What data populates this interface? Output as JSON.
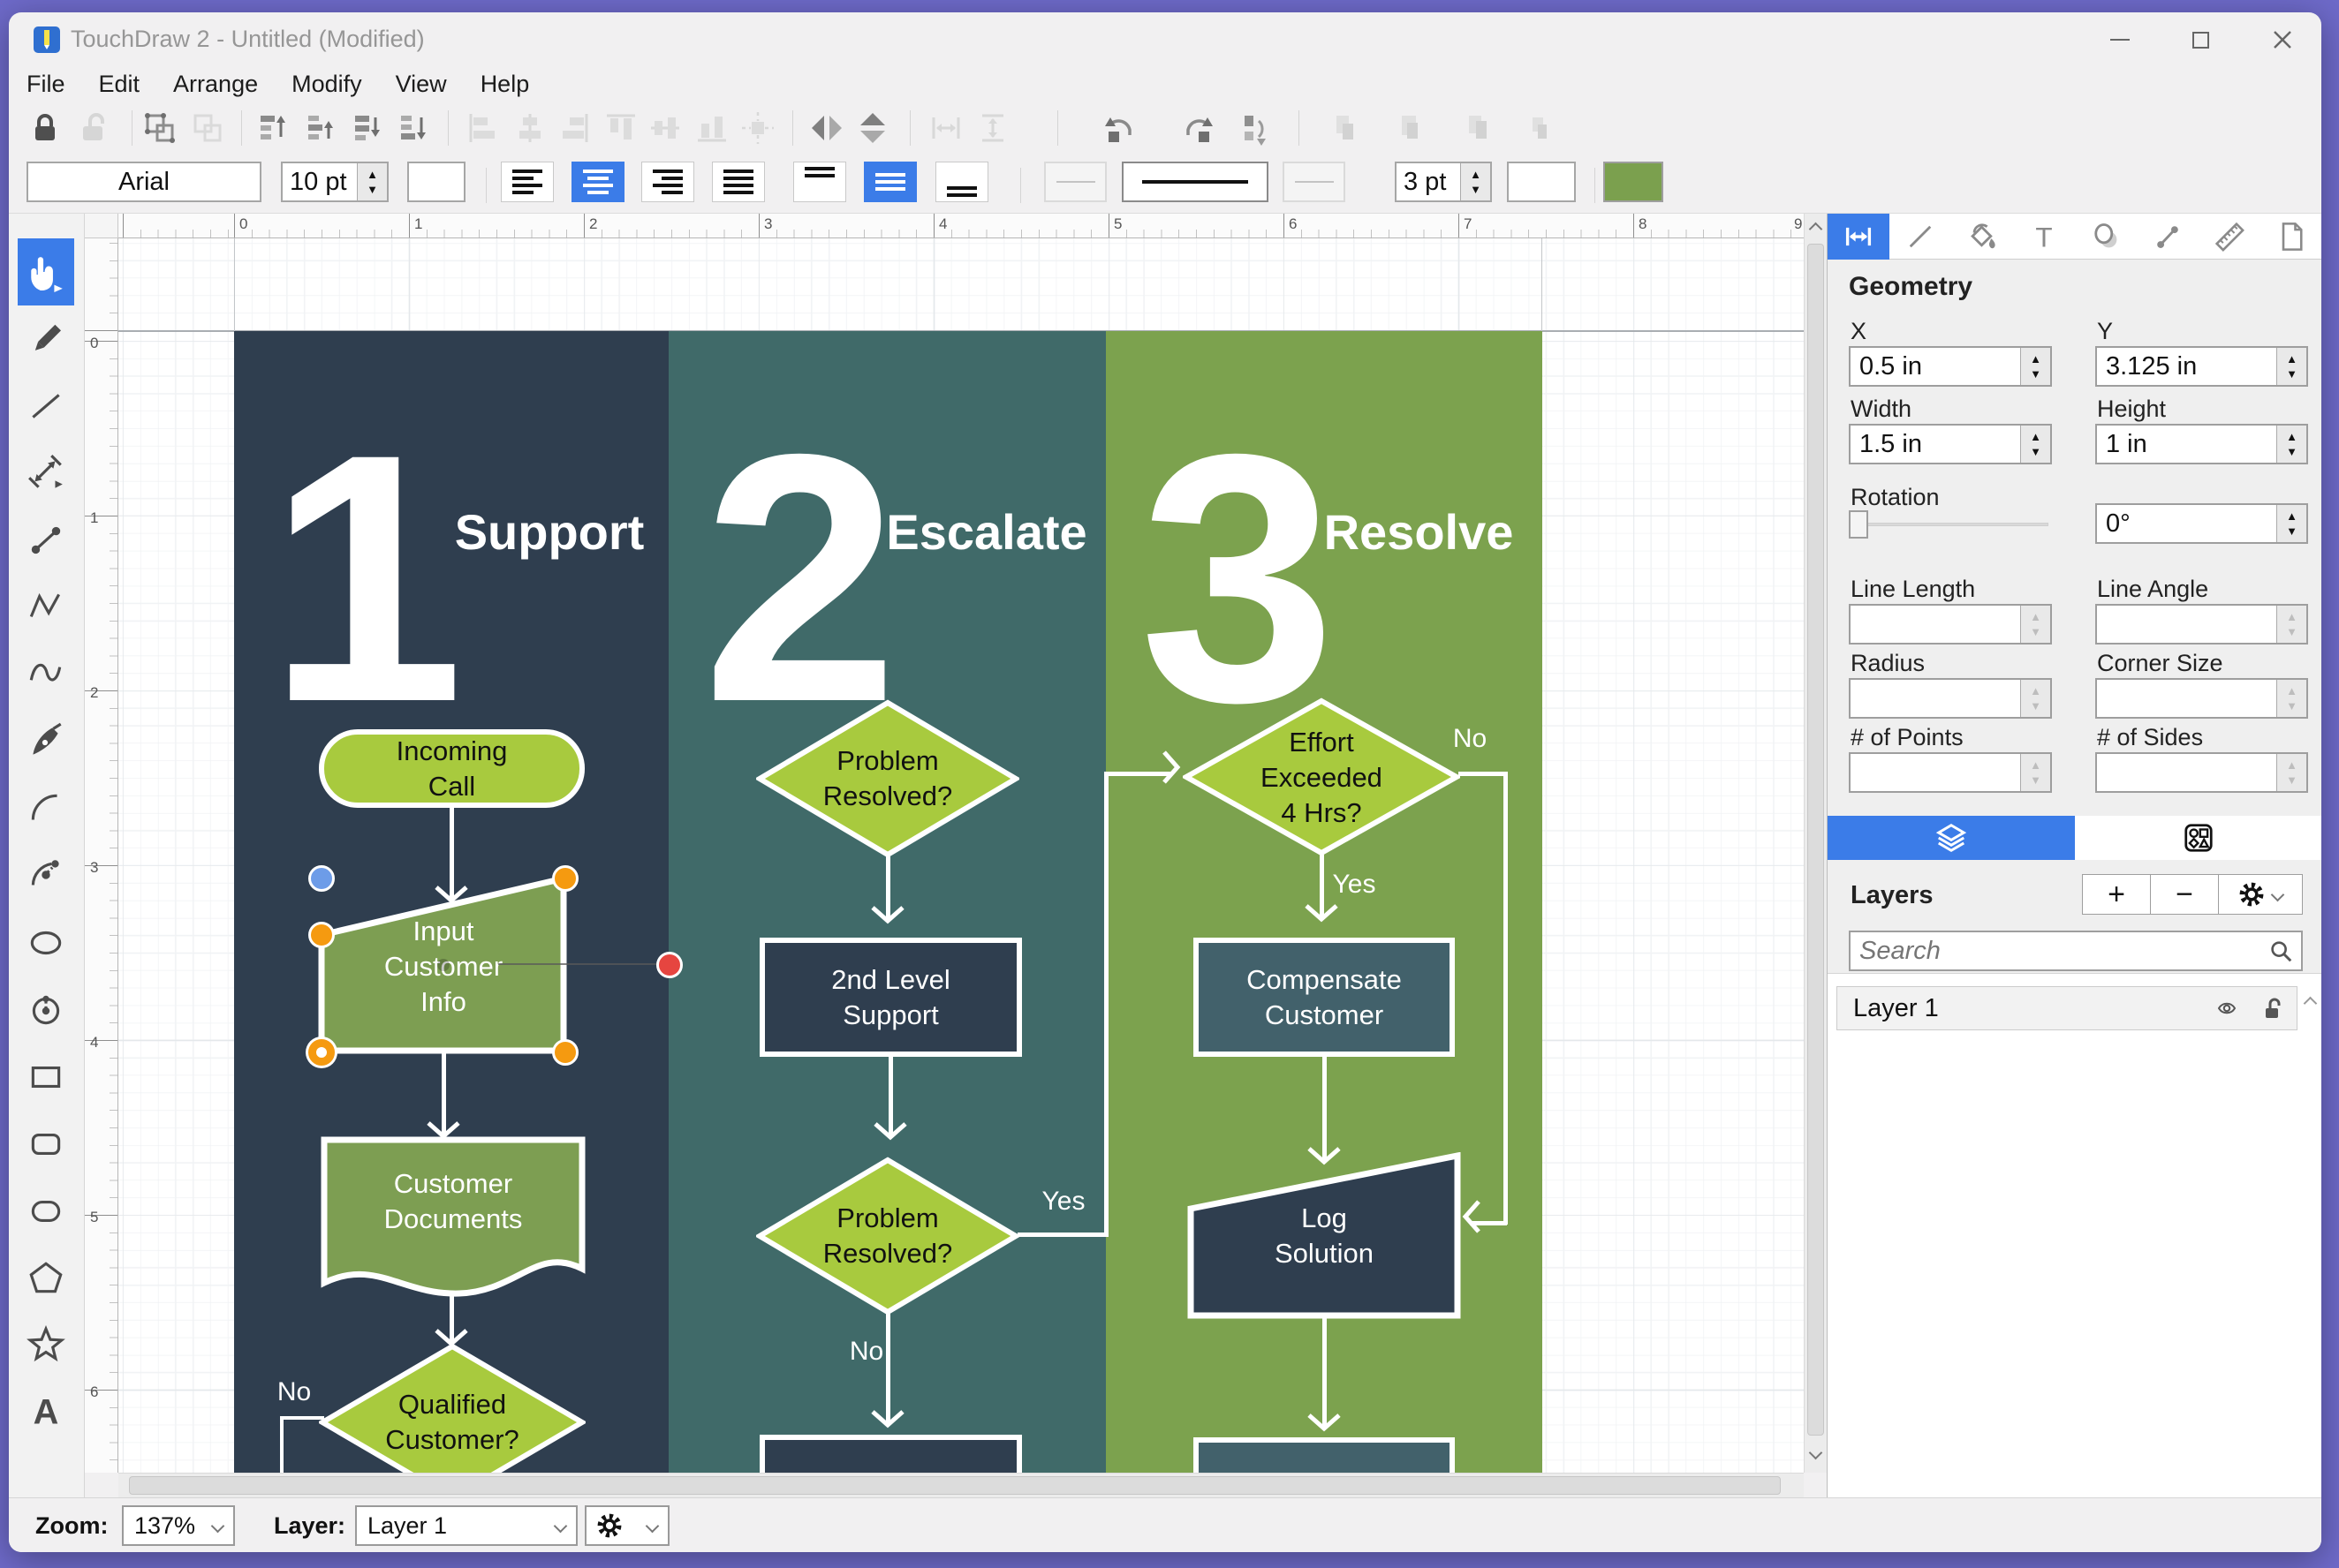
{
  "colors": {
    "desktop": "#6e6ac9",
    "accent": "#3b7ce8",
    "col1": "#2f3e4f",
    "col2": "#406a69",
    "col3": "#7ca24e",
    "bright_green": "#a8ca3e",
    "olive": "#7d9e52",
    "navy_box": "#2f3e4f",
    "teal_box": "#42616b",
    "fill_swatch": "#7ba04e",
    "handle_orange": "#f59a10",
    "handle_blue": "#6d9ce8",
    "handle_red": "#e64540"
  },
  "window": {
    "title": "TouchDraw 2 - Untitled (Modified)"
  },
  "menu": {
    "items": [
      "File",
      "Edit",
      "Arrange",
      "Modify",
      "View",
      "Help"
    ]
  },
  "format_toolbar": {
    "font_family": "Arial",
    "font_size": "10 pt",
    "stroke_width": "3 pt"
  },
  "tools": [
    "pan",
    "pencil",
    "line",
    "dimension",
    "connection",
    "polyline",
    "curve",
    "pen",
    "arc",
    "arc-point",
    "ellipse",
    "center-ellipse",
    "rectangle",
    "rounded-rectangle",
    "squircle",
    "polygon",
    "star",
    "text"
  ],
  "canvas": {
    "h_ruler": [
      "0",
      "1",
      "2",
      "3",
      "4",
      "5",
      "6",
      "7",
      "8",
      "9"
    ],
    "v_ruler": [
      "0",
      "1",
      "2",
      "3",
      "4",
      "5",
      "6"
    ]
  },
  "flowchart": {
    "columns": [
      {
        "number": "1",
        "title": "Support"
      },
      {
        "number": "2",
        "title": "Escalate"
      },
      {
        "number": "3",
        "title": "Resolve"
      }
    ],
    "nodes": {
      "incoming_call": "Incoming\nCall",
      "input_customer_info": "Input\nCustomer\nInfo",
      "customer_documents": "Customer\nDocuments",
      "qualified_customer": "Qualified\nCustomer?",
      "problem_resolved_1": "Problem\nResolved?",
      "second_level_support": "2nd Level\nSupport",
      "problem_resolved_2": "Problem\nResolved?",
      "effort_exceeded": "Effort\nExceeded\n4 Hrs?",
      "compensate_customer": "Compensate\nCustomer",
      "log_solution": "Log\nSolution"
    },
    "edge_labels": {
      "col1_no": "No",
      "col2_yes": "Yes",
      "col2_no": "No",
      "col3_no": "No",
      "col3_yes": "Yes"
    }
  },
  "panel": {
    "tabs": [
      "geometry",
      "line",
      "fill",
      "text",
      "shadow",
      "connection",
      "ruler",
      "page"
    ],
    "geometry": {
      "title": "Geometry",
      "x_label": "X",
      "x_value": "0.5 in",
      "y_label": "Y",
      "y_value": "3.125 in",
      "width_label": "Width",
      "width_value": "1.5 in",
      "height_label": "Height",
      "height_value": "1 in",
      "rotation_label": "Rotation",
      "rotation_value": "0°",
      "line_length_label": "Line Length",
      "line_angle_label": "Line Angle",
      "radius_label": "Radius",
      "corner_size_label": "Corner Size",
      "points_label": "# of Points",
      "sides_label": "# of Sides"
    },
    "layers": {
      "title": "Layers",
      "add": "+",
      "remove": "−",
      "search_placeholder": "Search",
      "items": [
        {
          "name": "Layer 1"
        }
      ]
    }
  },
  "status_bar": {
    "zoom_label": "Zoom:",
    "zoom_value": "137%",
    "layer_label": "Layer:",
    "layer_value": "Layer 1"
  }
}
